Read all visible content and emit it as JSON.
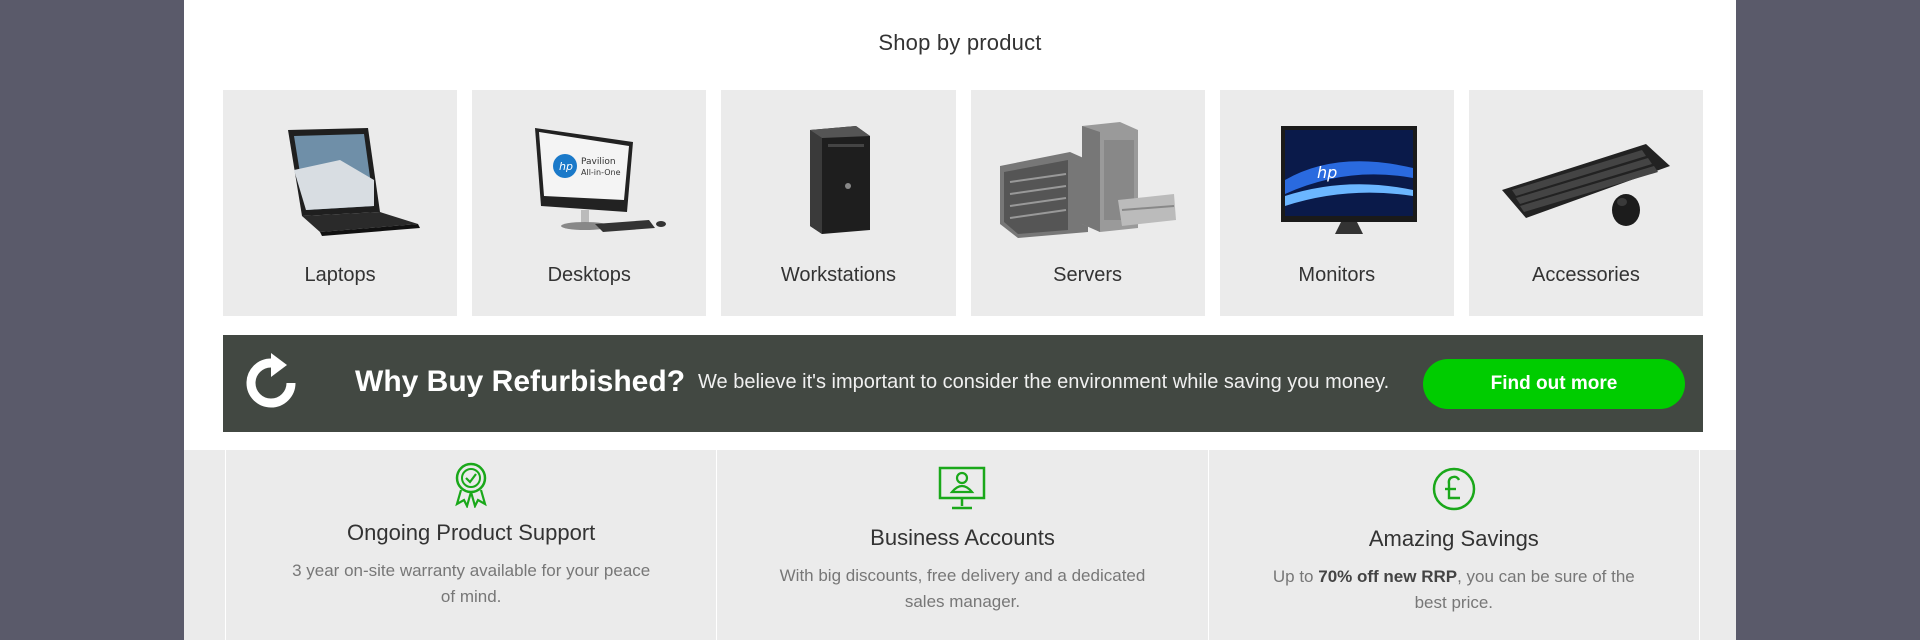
{
  "section_title": "Shop by product",
  "products": [
    {
      "label": "Laptops",
      "icon": "laptop-image"
    },
    {
      "label": "Desktops",
      "icon": "desktop-image"
    },
    {
      "label": "Workstations",
      "icon": "workstation-image"
    },
    {
      "label": "Servers",
      "icon": "servers-image"
    },
    {
      "label": "Monitors",
      "icon": "monitor-image"
    },
    {
      "label": "Accessories",
      "icon": "keyboard-mouse-image"
    }
  ],
  "banner": {
    "title": "Why Buy Refurbished?",
    "text": "We believe it's important to consider the environment while saving you money.",
    "cta": "Find out more",
    "icon": "refresh-icon"
  },
  "features": [
    {
      "title": "Ongoing Product Support",
      "desc": "3 year on-site warranty available for your peace of mind.",
      "icon": "award-ribbon-icon"
    },
    {
      "title": "Business Accounts",
      "desc": "With big discounts, free delivery and a dedicated sales manager.",
      "icon": "monitor-user-icon"
    },
    {
      "title": "Amazing Savings",
      "desc_pre": "Up to ",
      "desc_bold": "70% off new RRP",
      "desc_post": ", you can be sure of the best price.",
      "icon": "pound-icon"
    }
  ],
  "colors": {
    "accent": "#00cc00",
    "banner_bg": "#424842",
    "card_bg": "#ebebeb",
    "outer_bg": "#5a5a6a"
  }
}
